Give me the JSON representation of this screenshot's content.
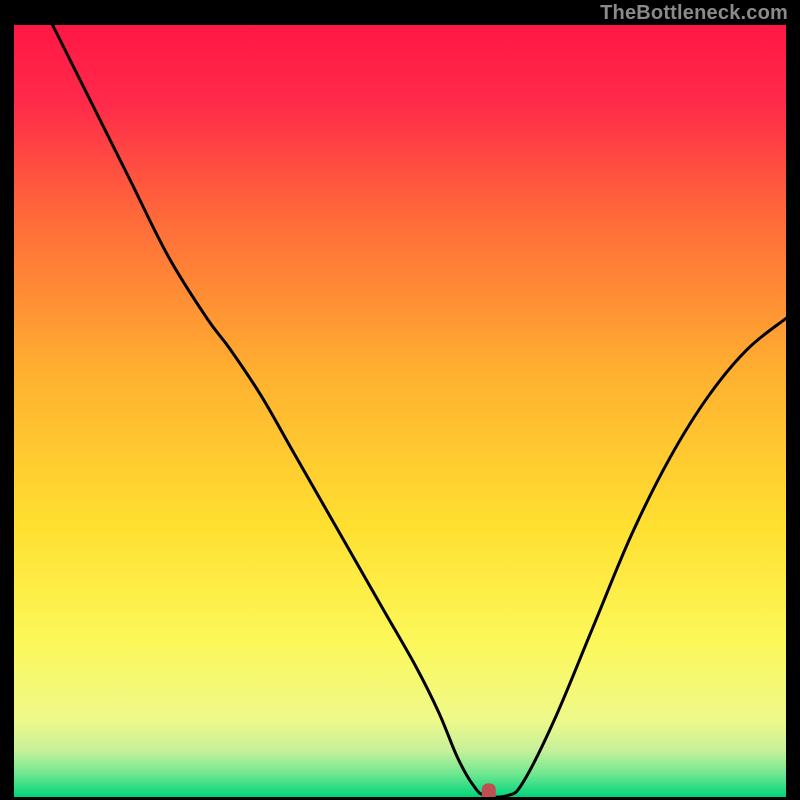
{
  "watermark": "TheBottleneck.com",
  "chart_data": {
    "type": "line",
    "title": "",
    "xlabel": "",
    "ylabel": "",
    "xlim": [
      0,
      100
    ],
    "ylim": [
      0,
      100
    ],
    "grid": false,
    "background_gradient": {
      "stops": [
        {
          "offset": 0.0,
          "color": "#ff1744"
        },
        {
          "offset": 0.1,
          "color": "#ff2a4a"
        },
        {
          "offset": 0.25,
          "color": "#ff6a3a"
        },
        {
          "offset": 0.45,
          "color": "#ffb030"
        },
        {
          "offset": 0.65,
          "color": "#ffe030"
        },
        {
          "offset": 0.8,
          "color": "#fcf85a"
        },
        {
          "offset": 0.9,
          "color": "#eef98a"
        },
        {
          "offset": 0.94,
          "color": "#c6f09a"
        },
        {
          "offset": 0.97,
          "color": "#70e890"
        },
        {
          "offset": 1.0,
          "color": "#00d47a"
        }
      ]
    },
    "series": [
      {
        "name": "bottleneck-curve",
        "color": "#000000",
        "x": [
          5,
          10,
          15,
          20,
          25,
          28,
          32,
          36,
          40,
          44,
          48,
          52,
          55,
          57.5,
          59.5,
          61,
          64,
          66,
          70,
          75,
          80,
          85,
          90,
          95,
          100
        ],
        "y": [
          100,
          90,
          80,
          70,
          62,
          58,
          52,
          45,
          38,
          31,
          24,
          17,
          11,
          5,
          1.5,
          0.2,
          0.2,
          2,
          10,
          22,
          34,
          44,
          52,
          58,
          62
        ]
      }
    ],
    "marker": {
      "name": "bottleneck-point",
      "x": 61.5,
      "y": 0.6,
      "color": "#c05050",
      "rx": 7,
      "ry": 9
    }
  }
}
